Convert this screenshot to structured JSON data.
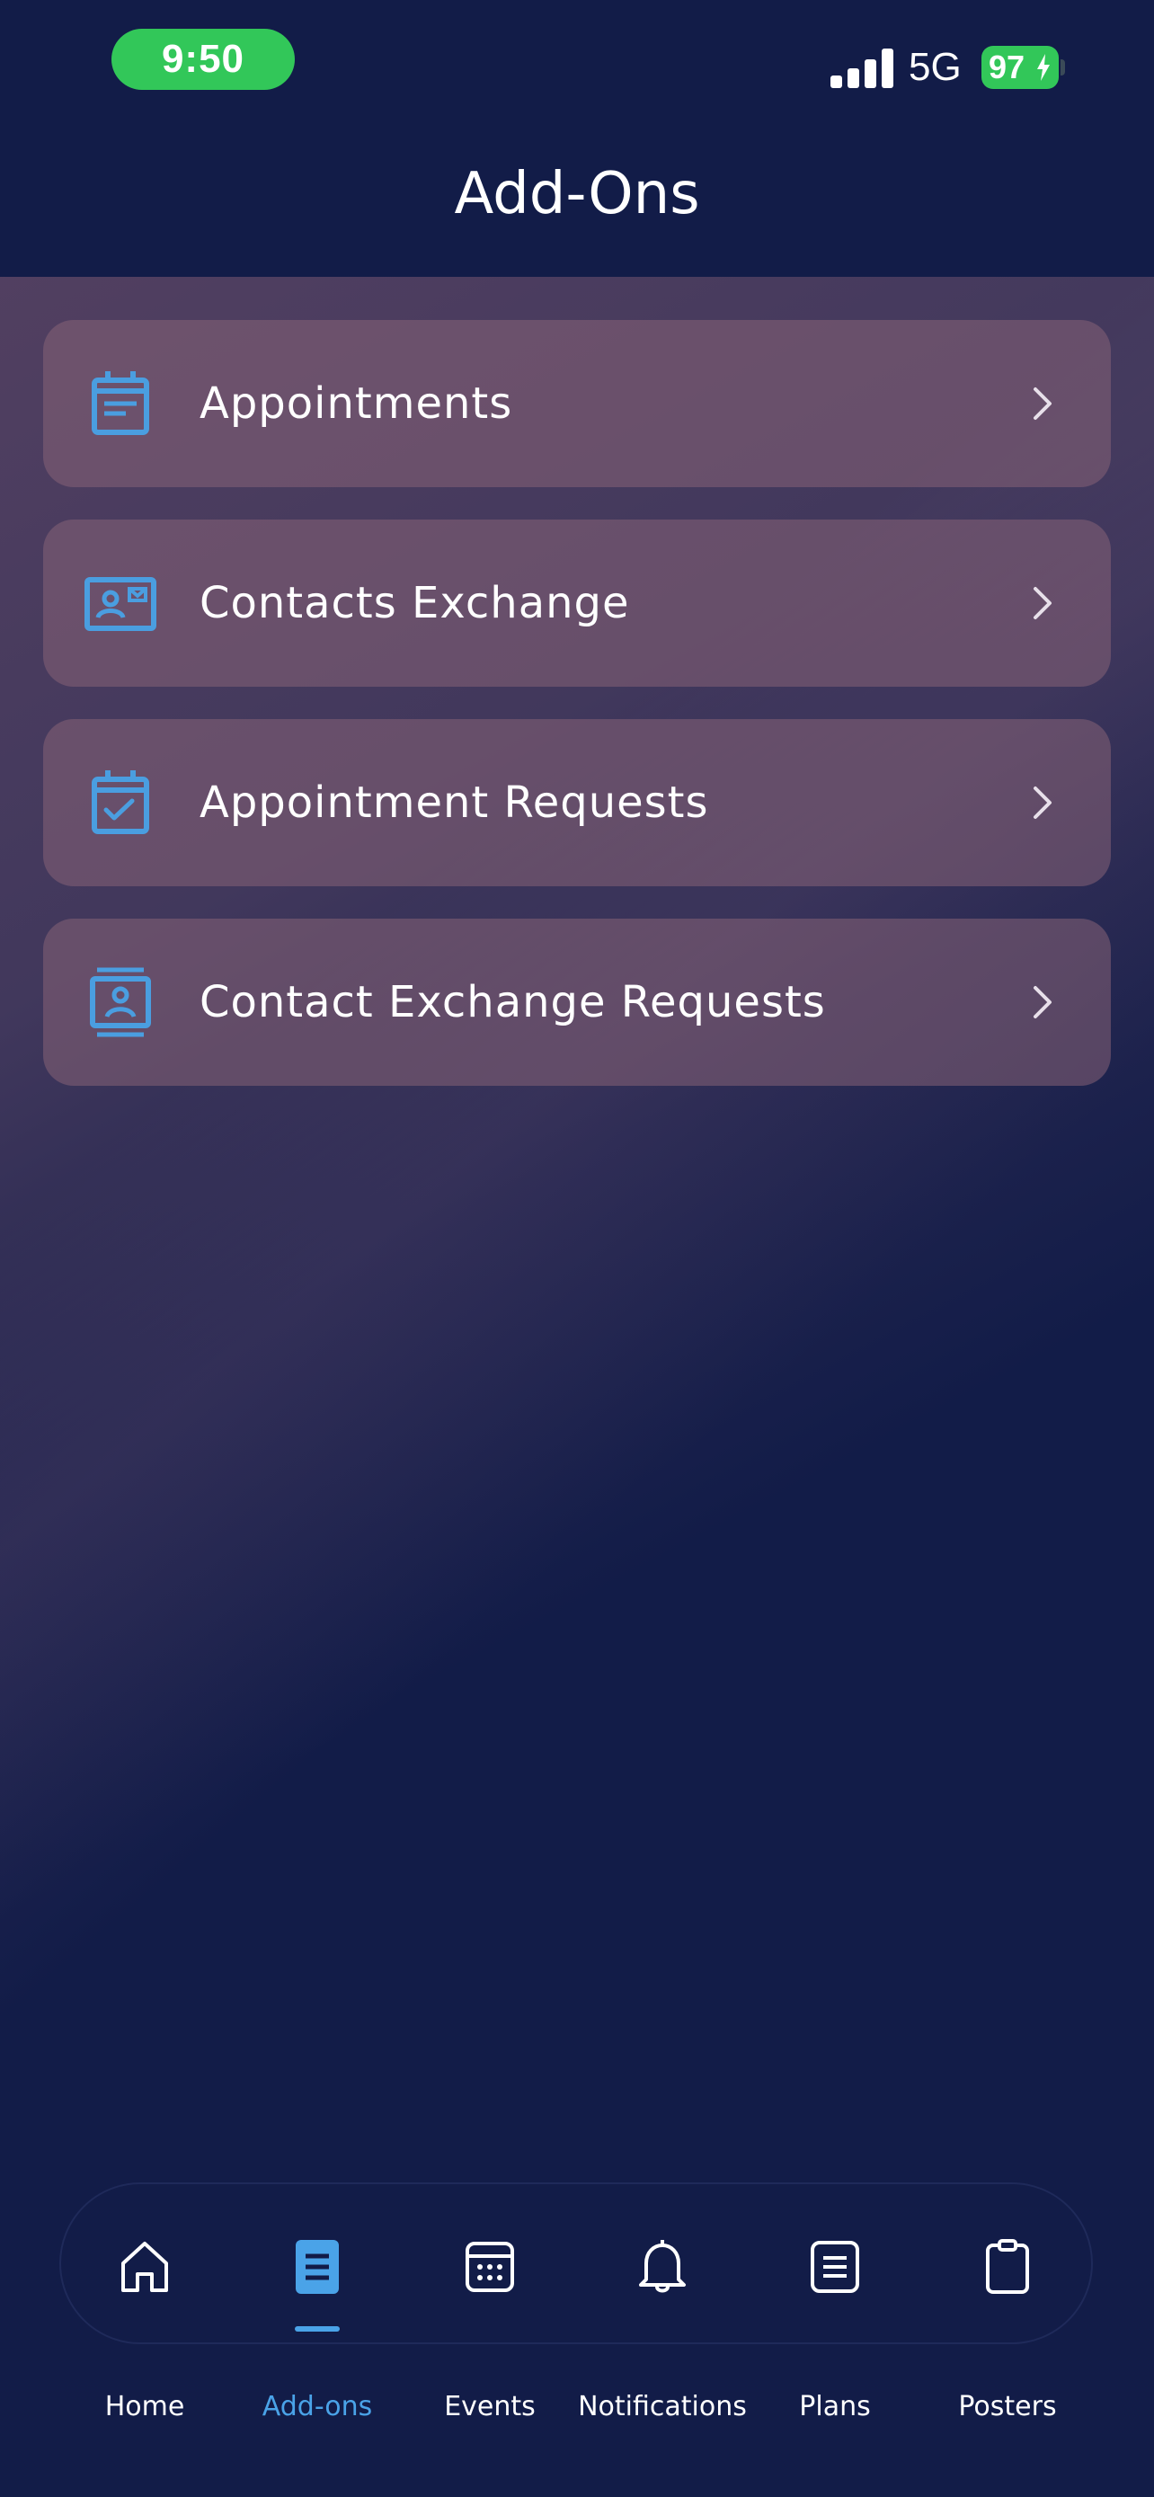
{
  "status_bar": {
    "time": "9:50",
    "network": "5G",
    "battery": "97"
  },
  "header": {
    "title": "Add-Ons"
  },
  "menu": {
    "items": [
      {
        "label": "Appointments",
        "icon": "calendar-note-icon"
      },
      {
        "label": "Contacts Exchange",
        "icon": "contact-card-icon"
      },
      {
        "label": "Appointment Requests",
        "icon": "calendar-check-icon"
      },
      {
        "label": "Contact Exchange Requests",
        "icon": "contact-book-icon"
      }
    ]
  },
  "tabs": [
    {
      "label": "Home",
      "icon": "home-icon",
      "active": false
    },
    {
      "label": "Add-ons",
      "icon": "document-icon",
      "active": true
    },
    {
      "label": "Events",
      "icon": "calendar-grid-icon",
      "active": false
    },
    {
      "label": "Notifications",
      "icon": "bell-icon",
      "active": false
    },
    {
      "label": "Plans",
      "icon": "list-icon",
      "active": false
    },
    {
      "label": "Posters",
      "icon": "clipboard-icon",
      "active": false
    }
  ],
  "colors": {
    "background": "#121c48",
    "accent": "#4aa3e8",
    "status_green": "#32c759",
    "card": "#876276"
  }
}
